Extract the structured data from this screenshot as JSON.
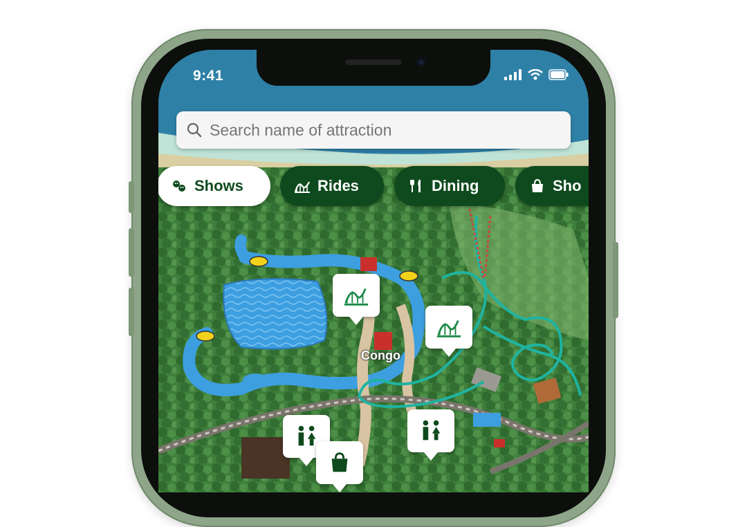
{
  "status_bar": {
    "time": "9:41",
    "icons": [
      "cellular-signal-icon",
      "wifi-icon",
      "battery-icon"
    ]
  },
  "search": {
    "placeholder": "Search name of attraction",
    "icon": "search-icon"
  },
  "filters": [
    {
      "label": "Shows",
      "icon": "shows-icon",
      "active": true
    },
    {
      "label": "Rides",
      "icon": "rides-icon",
      "active": false
    },
    {
      "label": "Dining",
      "icon": "dining-icon",
      "active": false
    },
    {
      "label": "Sho",
      "icon": "shop-icon",
      "active": false
    }
  ],
  "map": {
    "area_label": "Congo",
    "markers": [
      {
        "type": "ride",
        "icon": "rollercoaster-icon"
      },
      {
        "type": "ride",
        "icon": "rollercoaster-icon"
      },
      {
        "type": "restroom",
        "icon": "restroom-icon"
      },
      {
        "type": "restroom",
        "icon": "restroom-icon"
      },
      {
        "type": "shop",
        "icon": "shop-icon"
      }
    ]
  },
  "colors": {
    "chip_active_bg": "#ffffff",
    "chip_inactive_bg": "#0e4a1d",
    "brand_green": "#0f4a1e",
    "water": "#3d9fe0",
    "coaster_track": "#1fb3a0",
    "phone_frame": "#8fa58a"
  }
}
